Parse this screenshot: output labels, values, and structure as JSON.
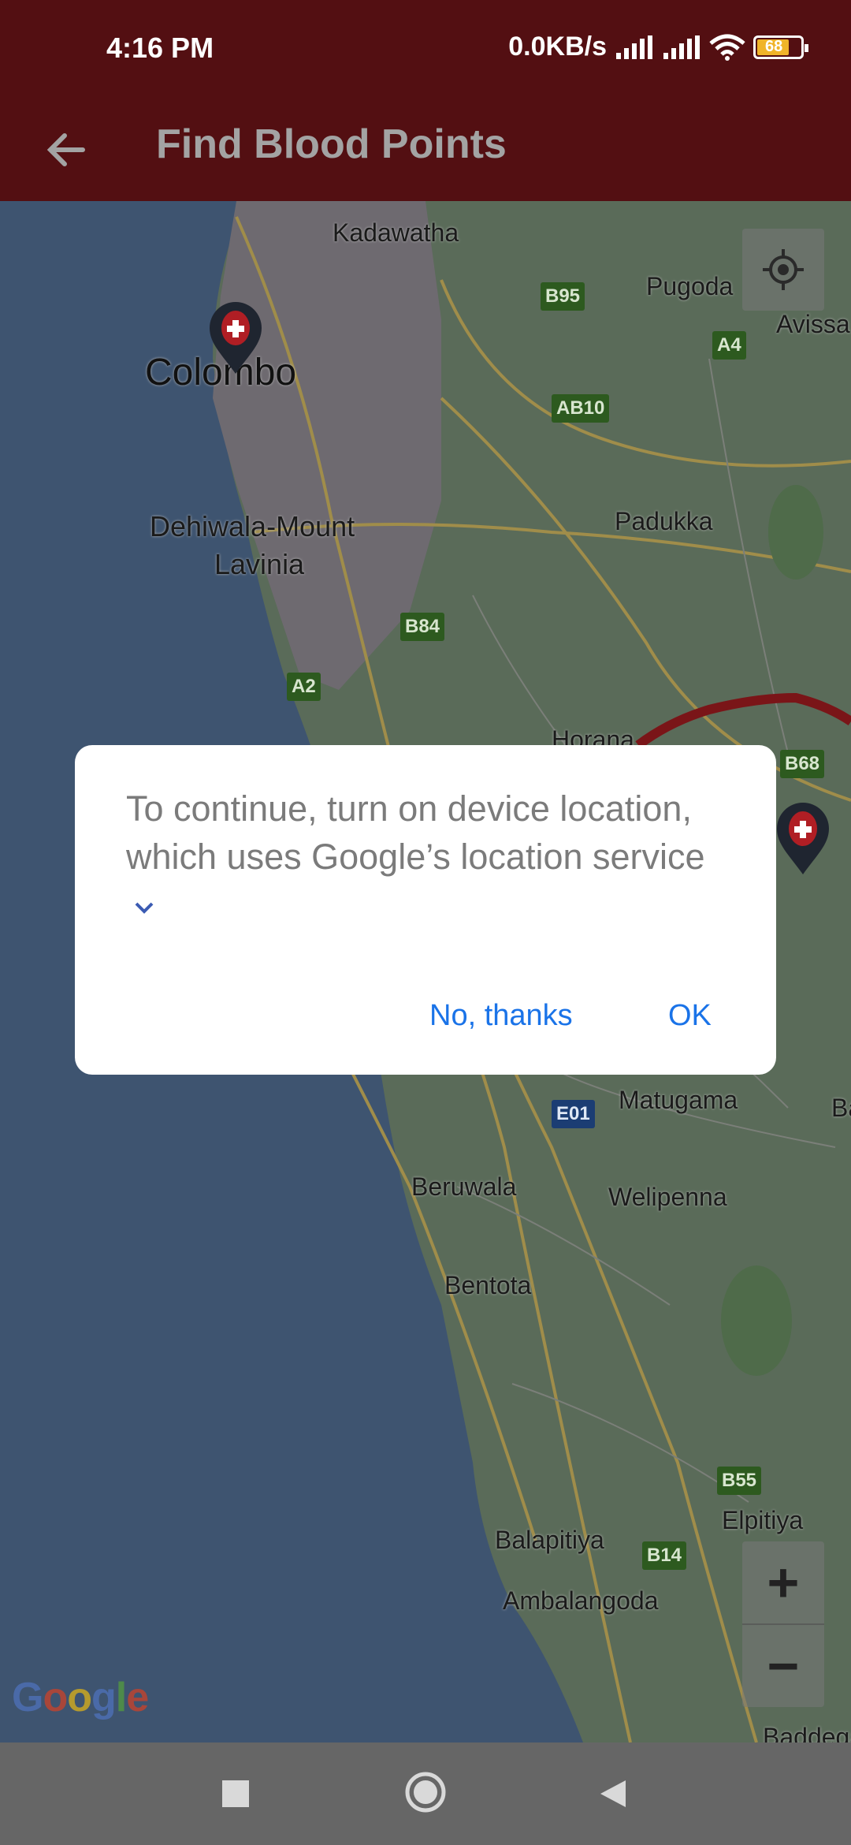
{
  "status_bar": {
    "time": "4:16 PM",
    "network_speed": "0.0KB/s",
    "battery": "68",
    "icons": [
      "signal-icon",
      "signal-icon",
      "wifi-icon",
      "battery-icon"
    ]
  },
  "app_bar": {
    "title": "Find Blood Points",
    "back_icon": "arrow-left-icon"
  },
  "map": {
    "labels": [
      "Kadawatha",
      "Pugoda",
      "Avissa",
      "Colombo",
      "Dehiwala-Mount",
      "Lavinia",
      "Padukka",
      "Horana",
      "Matugama",
      "Ba",
      "Beruwala",
      "Welipenna",
      "Bentota",
      "Elpitiya",
      "Balapitiya",
      "Ambalangoda",
      "Baddegam"
    ],
    "road_badges": [
      "B95",
      "A4",
      "AB10",
      "B84",
      "A2",
      "B68",
      "E01",
      "B55",
      "B14"
    ],
    "controls": {
      "my_location_icon": "crosshair-icon",
      "zoom_in": "+",
      "zoom_out": "−"
    },
    "logo": "Google"
  },
  "dialog": {
    "message": "To continue, turn on device location, which uses Google’s location service",
    "chevron_icon": "chevron-down-icon",
    "negative_button": "No, thanks",
    "positive_button": "OK"
  },
  "nav_bar": {
    "recents_icon": "square-icon",
    "home_icon": "circle-icon",
    "back_icon": "triangle-back-icon"
  },
  "colors": {
    "app_bar": "#530f12",
    "accent": "#1a73e8",
    "nav_bar": "#666666"
  }
}
